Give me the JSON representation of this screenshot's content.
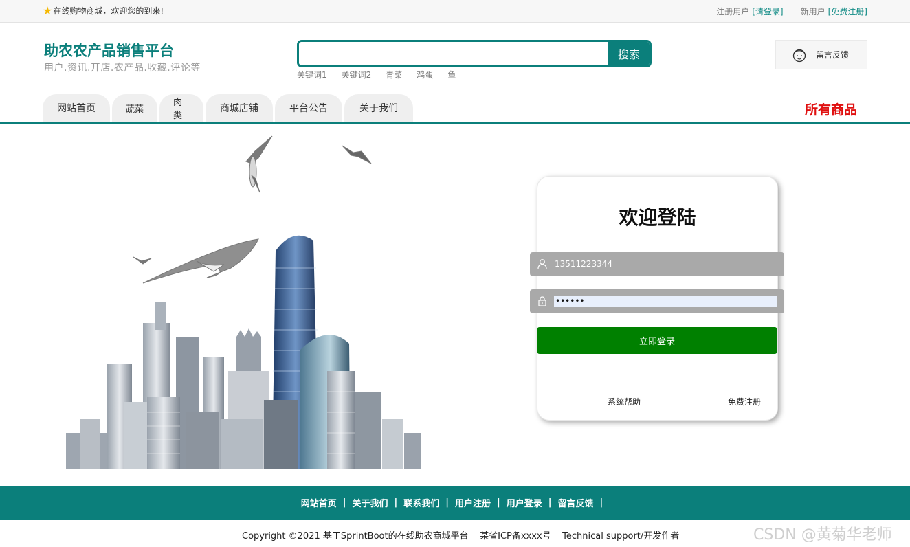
{
  "topbar": {
    "welcome": "在线购物商城，欢迎您的到来!",
    "registered_user": "注册用户",
    "login_link": "[请登录]",
    "new_user": "新用户",
    "register_link": "[免费注册]"
  },
  "header": {
    "site_title": "助农农产品销售平台",
    "site_subtitle": "用户.资讯.开店.农产品.收藏.评论等",
    "search": {
      "placeholder": "",
      "button": "搜索"
    },
    "hot_words": [
      "关键词1",
      "关键词2",
      "青菜",
      "鸡蛋",
      "鱼"
    ],
    "feedback": "留言反馈"
  },
  "nav": {
    "items": [
      "网站首页",
      "蔬菜",
      "肉类",
      "商城店铺",
      "平台公告",
      "关于我们"
    ],
    "all_goods": "所有商品"
  },
  "login": {
    "title": "欢迎登陆",
    "username": "13511223344",
    "password_mask": "••••••",
    "submit": "立即登录",
    "help": "系统帮助",
    "register": "免费注册"
  },
  "footer": {
    "links": [
      "网站首页",
      "关于我们",
      "联系我们",
      "用户注册",
      "用户登录",
      "留言反馈"
    ],
    "copyright": "Copyright ©2021 基于SprintBoot的在线助农商城平台    某省ICP备xxxx号    Technical support/开发作者"
  },
  "watermark": "CSDN @黄菊华老师",
  "colors": {
    "brand": "#0b7f7b",
    "login_button": "#008000",
    "all_goods": "#e01010"
  }
}
